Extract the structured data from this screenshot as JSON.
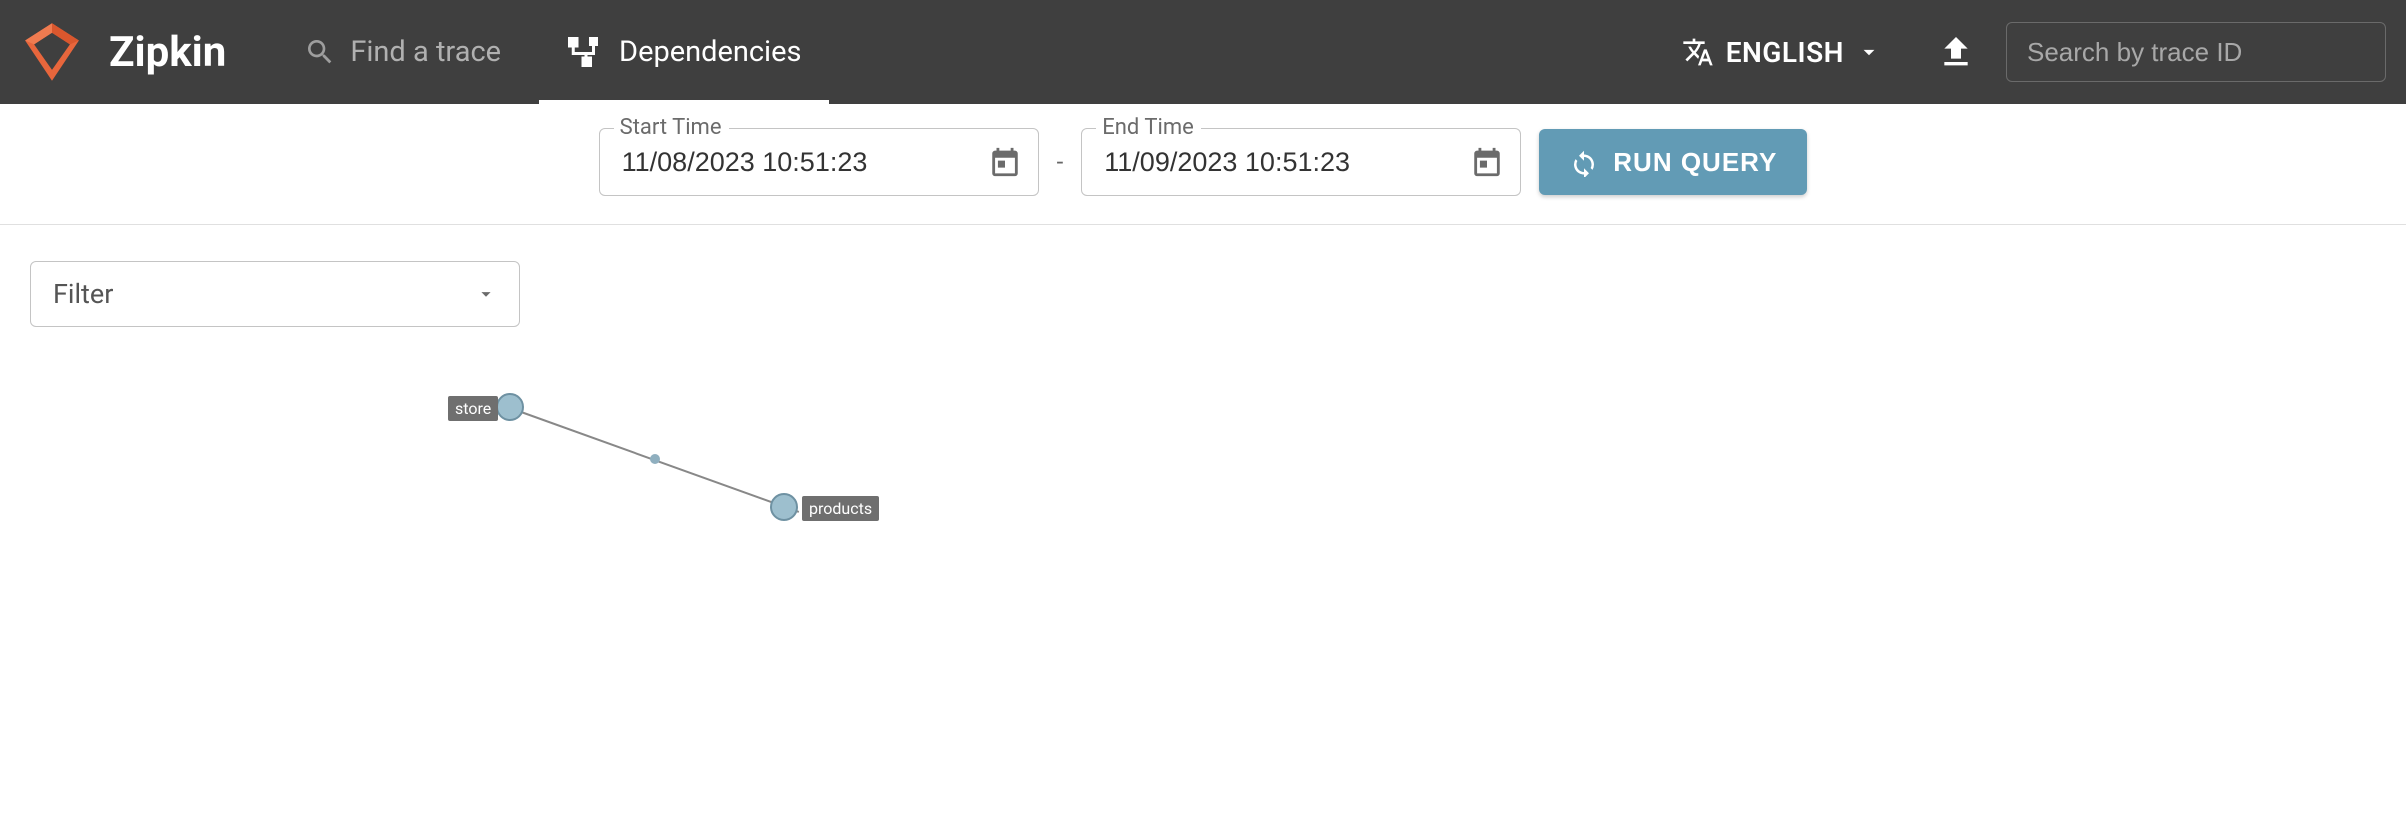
{
  "header": {
    "brand": "Zipkin",
    "find_trace_placeholder": "Find a trace",
    "dependencies_label": "Dependencies",
    "language_label": "ENGLISH",
    "search_placeholder": "Search by trace ID"
  },
  "toolbar": {
    "start_label": "Start Time",
    "start_value": "11/08/2023 10:51:23",
    "end_label": "End Time",
    "end_value": "11/09/2023 10:51:23",
    "separator": "-",
    "run_label": "RUN QUERY"
  },
  "filter": {
    "label": "Filter"
  },
  "graph": {
    "nodes": [
      {
        "id": "store",
        "label": "store"
      },
      {
        "id": "products",
        "label": "products"
      }
    ],
    "edges": [
      {
        "from": "store",
        "to": "products"
      }
    ]
  }
}
